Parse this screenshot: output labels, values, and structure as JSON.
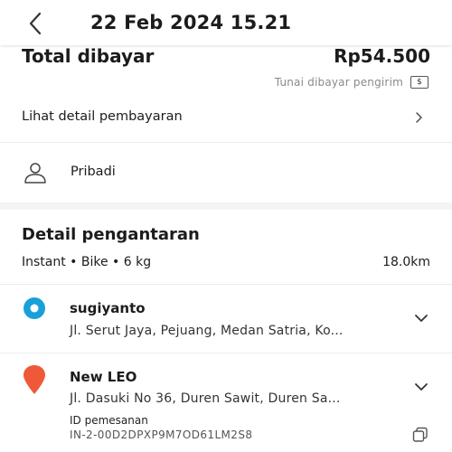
{
  "header": {
    "title": "22 Feb 2024 15.21",
    "back_icon": "chevron-left-icon"
  },
  "payment": {
    "total_label": "Total dibayar",
    "total_value": "Rp54.500",
    "cash_note": "Tunai dibayar pengirim",
    "cash_icon_glyph": "$",
    "detail_link": "Lihat detail pembayaran"
  },
  "profile": {
    "label": "Pribadi",
    "icon": "person-icon"
  },
  "delivery": {
    "title": "Detail pengantaran",
    "meta": "Instant • Bike • 6 kg",
    "distance": "18.0km",
    "origin": {
      "name": "sugiyanto",
      "address": "Jl. Serut Jaya, Pejuang, Medan Satria, Ko...",
      "icon_color": "#1aa0d8"
    },
    "destination": {
      "name": "New LEO",
      "address": "Jl. Dasuki No 36, Duren Sawit, Duren Sa...",
      "icon_color": "#ee5a38",
      "order_label": "ID pemesanan",
      "order_id": "IN-2-00D2DPXP9M7OD61LM2S8"
    }
  }
}
